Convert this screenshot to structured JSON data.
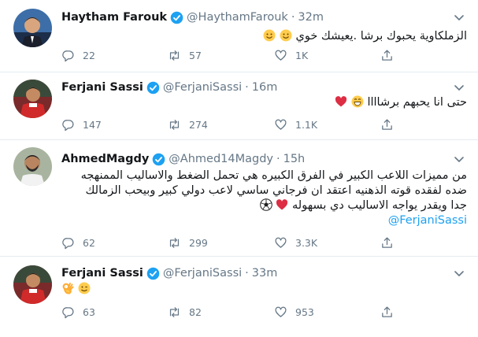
{
  "tweets": [
    {
      "name": "Haytham Farouk",
      "handle": "@HaythamFarouk",
      "time": "32m",
      "text": "الزملكاوية يحبوك برشا .يعيشك خوي",
      "emoji": [
        "smile",
        "smile"
      ],
      "replies": "22",
      "retweets": "57",
      "likes": "1K",
      "avatar": "suit-man"
    },
    {
      "name": "Ferjani Sassi",
      "handle": "@FerjaniSassi",
      "time": "16m",
      "text": "حتى انا يحبهم برشاااا",
      "emoji": [
        "grin",
        "heart"
      ],
      "replies": "147",
      "retweets": "274",
      "likes": "1.1K",
      "avatar": "footballer-red"
    },
    {
      "name": "AhmedMagdy",
      "handle": "@Ahmed14Magdy",
      "time": "15h",
      "lines": [
        "من مميزات اللاعب الكبير في الفرق الكبيره هي تحمل الضغط والاساليب الممنهجه",
        "ضده لفقده قوته الذهنيه اعتقد ان فرجاني ساسي لاعب دولي كبير وبيحب الزمالك",
        "جدا ويقدر يواجه الاساليب دي بسهوله"
      ],
      "emoji": [
        "heart",
        "soccer"
      ],
      "mention": "@FerjaniSassi",
      "replies": "62",
      "retweets": "299",
      "likes": "3.3K",
      "avatar": "bearded-man"
    },
    {
      "name": "Ferjani Sassi",
      "handle": "@FerjaniSassi",
      "time": "33m",
      "emoji": [
        "wink",
        "ok-hand"
      ],
      "replies": "63",
      "retweets": "82",
      "likes": "953",
      "avatar": "footballer-red"
    }
  ],
  "colors": {
    "text": "#14171a",
    "secondary": "#657786",
    "link": "#1da1f2",
    "verified": "#1da1f2",
    "divider": "#e6ecf0",
    "heart": "#e0245e"
  },
  "icons": [
    "reply-icon",
    "retweet-icon",
    "like-icon",
    "share-icon",
    "verified-badge-icon",
    "chevron-down-icon"
  ]
}
